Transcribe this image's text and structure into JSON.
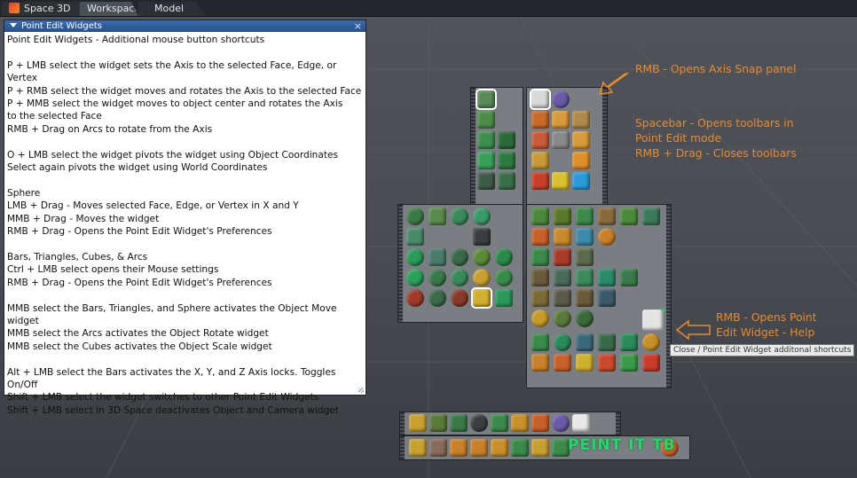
{
  "tabs": [
    {
      "label": "Space 3D"
    },
    {
      "label": "Workspace"
    },
    {
      "label": "Model"
    }
  ],
  "panel": {
    "title": "Point Edit Widgets",
    "close_glyph": "×",
    "body": "Point Edit Widgets - Additional mouse button shortcuts\n\nP + LMB select the widget sets the Axis to the selected Face, Edge, or Vertex\nP + RMB select the widget moves and rotates the Axis to the selected Face\nP + MMB select the widget moves to object center and rotates the Axis\nto the selected Face\nRMB + Drag on Arcs to rotate from the Axis\n\nO + LMB select the widget pivots the widget using Object Coordinates\nSelect again pivots the widget using World Coordinates\n\nSphere\nLMB + Drag - Moves selected Face, Edge, or Vertex in X and Y\nMMB + Drag - Moves the widget\nRMB + Drag - Opens the Point Edit Widget's Preferences\n\nBars, Triangles, Cubes, & Arcs\nCtrl + LMB select opens their Mouse settings\nRMB + Drag - Opens the Point Edit Widget's Preferences\n\nMMB select the Bars, Triangles, and Sphere activates the Object Move widget\nMMB select the Arcs activates the Object Rotate widget\nMMB select the Cubes activates the Object Scale widget\n\nAlt + LMB select the Bars activates the X, Y, and Z Axis locks. Toggles On/Off\nShift + LMB select the widget switches to other Point Edit Widgets\nShift + LMB select in 3D Space deactivates Object and Camera widget"
  },
  "notes": {
    "axis_snap": "RMB - Opens Axis Snap panel",
    "spacebar": "Spacebar - Opens toolbars in\nPoint Edit mode\nRMB + Drag - Closes toolbars",
    "help": "RMB - Opens Point\nEdit Widget - Help"
  },
  "tooltip": "Close / Point Edit Widget additonal shortcuts",
  "wordmark": "PEINT IT TB",
  "colors": {
    "accent_orange": "#e98a2c",
    "title_blue": "#2f5c9c",
    "widget_green": "#29d46b"
  },
  "toolbars": {
    "widget_toolbar_icons": [
      "sphere-icon",
      "cone-icon",
      "sphere-icon",
      "sphere-cursor-icon",
      "cube-icon",
      "cube-icon",
      "cube-icon",
      "cube-icon",
      "bars-icon",
      "ring-icon",
      "sphere-icon",
      "cube-icon",
      "sphere-icon",
      "sphere-icon",
      "sphere-icon",
      "sphere-icon"
    ],
    "axis_toolbar_icons": [
      "axis-icon",
      "orbit-icon",
      "mesh-icon",
      "stairs-icon",
      "axis-x-icon",
      "cube-icon",
      "x-letter-icon",
      "y-letter-icon",
      "z-letter-icon"
    ],
    "bottom_toolbar_icons": [
      "tube-icon",
      "cube-icon",
      "cube-icon",
      "sphere-icon",
      "ring-icon",
      "arrows-icon",
      "orbit-icon",
      "star-icon"
    ]
  }
}
